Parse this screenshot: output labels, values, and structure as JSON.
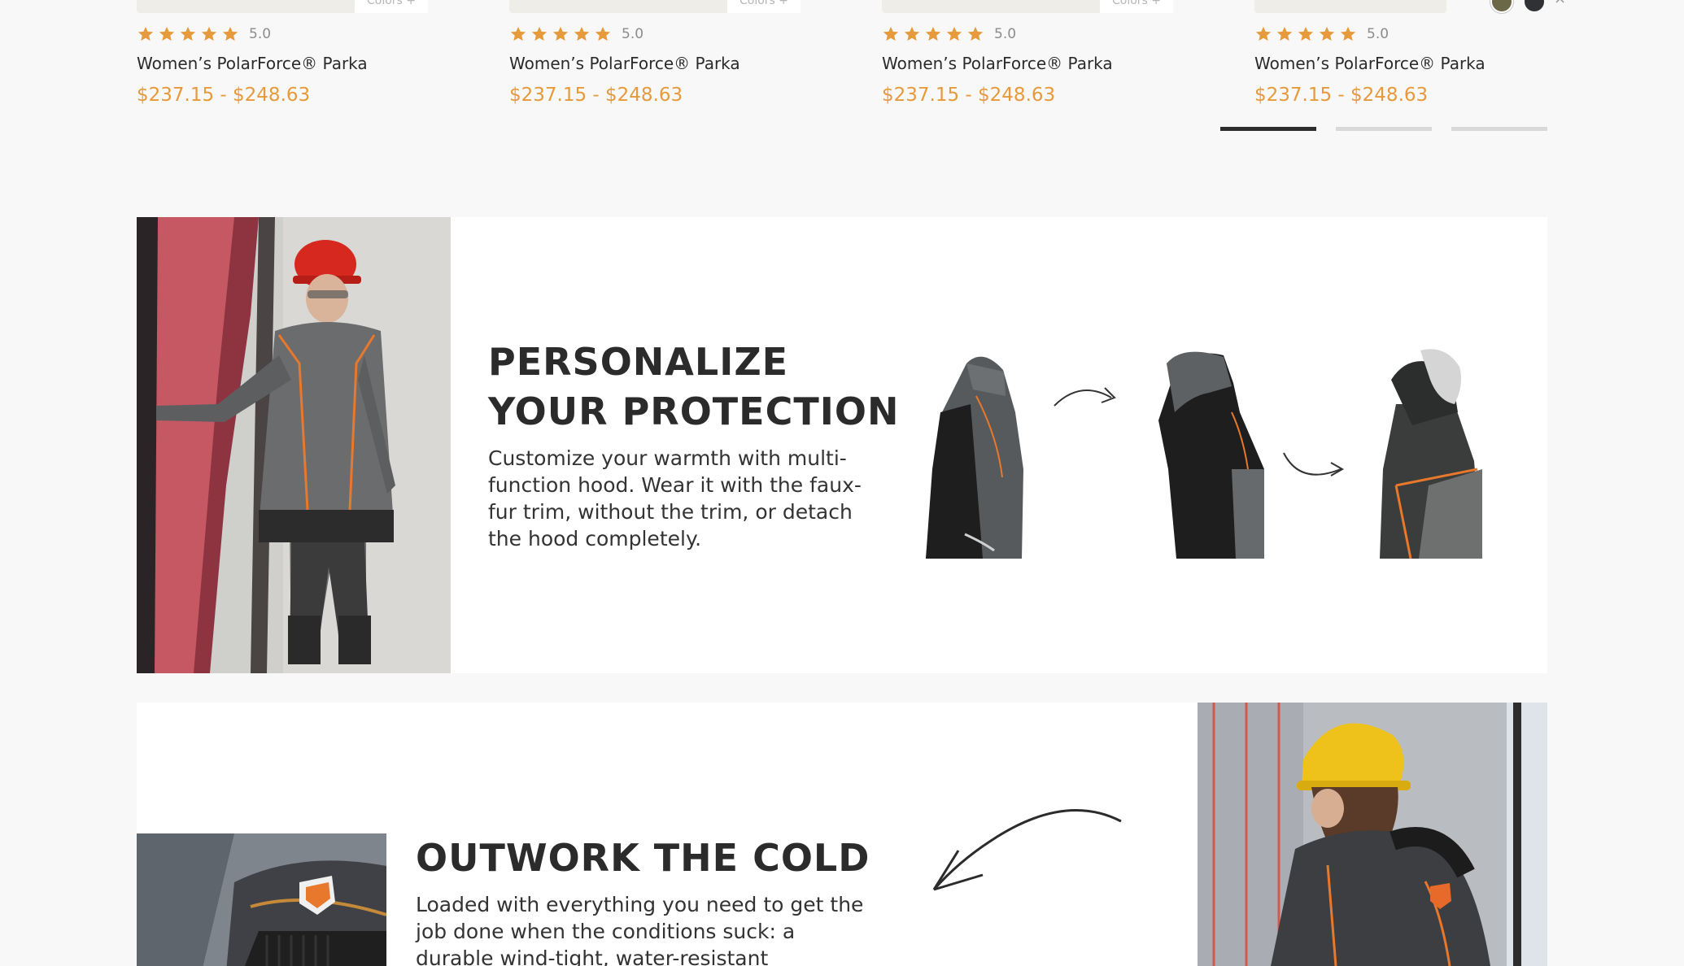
{
  "products": [
    {
      "title": "Women’s PolarForce® Parka",
      "price": "$237.15 - $248.63",
      "rating": "5.0",
      "stars": 5,
      "tag": "Colors +"
    },
    {
      "title": "Women’s PolarForce® Parka",
      "price": "$237.15 - $248.63",
      "rating": "5.0",
      "stars": 5,
      "tag": "Colors +"
    },
    {
      "title": "Women’s PolarForce® Parka",
      "price": "$237.15 - $248.63",
      "rating": "5.0",
      "stars": 5,
      "tag": "Colors +"
    },
    {
      "title": "Women’s PolarForce® Parka",
      "price": "$237.15 - $248.63",
      "rating": "5.0",
      "stars": 5,
      "swatch_close": "×"
    }
  ],
  "pager": {
    "count": 3,
    "active_index": 0
  },
  "personalize": {
    "title": "PERSONALIZE YOUR PROTECTION",
    "text": "Customize your warmth with multi-function hood. Wear it with the faux-fur trim, without the trim, or detach the hood completely."
  },
  "outwork": {
    "title": "OUTWORK THE COLD",
    "text": "Loaded with everything you need to get the job done when the conditions suck: a durable wind-tight, water-resistant outershell & "
  },
  "colors": {
    "accent": "#e79a3b",
    "text": "#2b2b2b",
    "page_bg": "#f8f8f8",
    "section_bg": "#ffffff"
  }
}
